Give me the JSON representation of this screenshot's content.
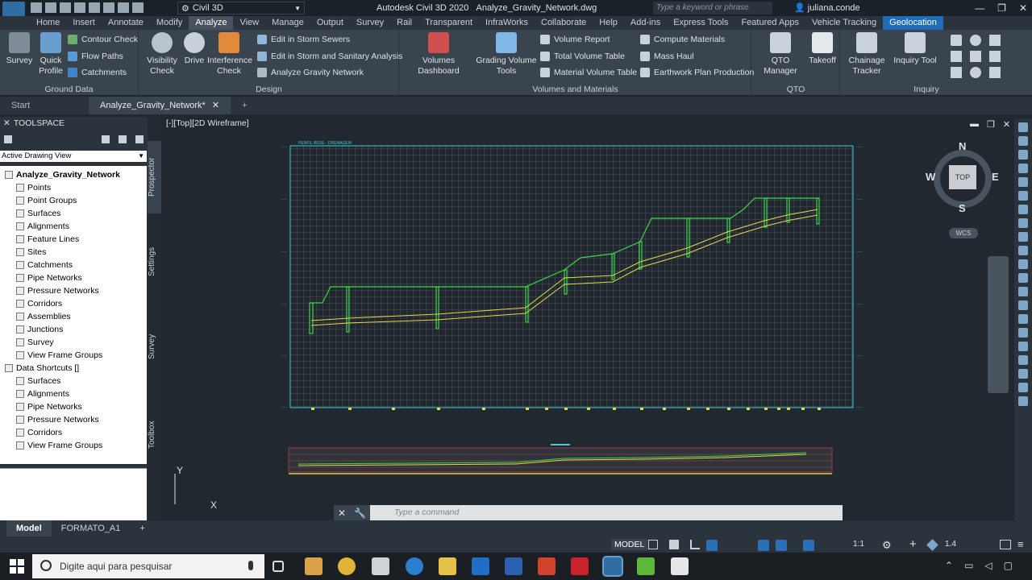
{
  "titlebar": {
    "logo_text": "C3D",
    "workspace": "Civil 3D",
    "title": "Autodesk Civil 3D 2020",
    "file": "Analyze_Gravity_Network.dwg",
    "search_placeholder": "Type a keyword or phrase",
    "user": "juliana.conde"
  },
  "tabs": [
    "Home",
    "Insert",
    "Annotate",
    "Modify",
    "Analyze",
    "View",
    "Manage",
    "Output",
    "Survey",
    "Rail",
    "Transparent",
    "InfraWorks",
    "Collaborate",
    "Help",
    "Add-ins",
    "Express Tools",
    "Featured Apps",
    "Vehicle Tracking",
    "Geolocation"
  ],
  "active_tab": "Analyze",
  "ribbon": {
    "ground": {
      "title": "Ground Data",
      "survey": "Survey",
      "quick_profile": "Quick Profile",
      "contour_check": "Contour Check",
      "flow_paths": "Flow Paths",
      "catchments": "Catchments"
    },
    "design": {
      "title": "Design",
      "visibility": "Visibility Check",
      "drive": "Drive",
      "interference": "Interference Check",
      "storm": "Edit in Storm Sewers",
      "storm_sanitary": "Edit in Storm and Sanitary Analysis",
      "gravity": "Analyze Gravity Network"
    },
    "volumes": {
      "title": "Volumes and Materials",
      "dashboard": "Volumes Dashboard",
      "grading": "Grading Volume Tools",
      "volume_report": "Volume Report",
      "total_volume": "Total Volume Table",
      "material_volume": "Material Volume Table",
      "compute": "Compute Materials",
      "mass_haul": "Mass Haul",
      "earthwork": "Earthwork Plan Production"
    },
    "qto": {
      "title": "QTO",
      "manager": "QTO Manager",
      "takeoff": "Takeoff"
    },
    "inquiry": {
      "title": "Inquiry",
      "chainage": "Chainage Tracker",
      "inquiry_tool": "Inquiry Tool"
    }
  },
  "doc_tabs": [
    "Start",
    "Analyze_Gravity_Network*"
  ],
  "toolspace": {
    "title": "TOOLSPACE",
    "view": "Active Drawing View",
    "tree": [
      {
        "label": "Analyze_Gravity_Network",
        "level": 0,
        "bold": true
      },
      {
        "label": "Points",
        "level": 1
      },
      {
        "label": "Point Groups",
        "level": 1
      },
      {
        "label": "Surfaces",
        "level": 1
      },
      {
        "label": "Alignments",
        "level": 1
      },
      {
        "label": "Feature Lines",
        "level": 1
      },
      {
        "label": "Sites",
        "level": 1
      },
      {
        "label": "Catchments",
        "level": 1
      },
      {
        "label": "Pipe Networks",
        "level": 1
      },
      {
        "label": "Pressure Networks",
        "level": 1
      },
      {
        "label": "Corridors",
        "level": 1
      },
      {
        "label": "Assemblies",
        "level": 1
      },
      {
        "label": "Junctions",
        "level": 1
      },
      {
        "label": "Survey",
        "level": 1
      },
      {
        "label": "View Frame Groups",
        "level": 1
      },
      {
        "label": "Data Shortcuts []",
        "level": 0
      },
      {
        "label": "Surfaces",
        "level": 1
      },
      {
        "label": "Alignments",
        "level": 1
      },
      {
        "label": "Pipe Networks",
        "level": 1
      },
      {
        "label": "Pressure Networks",
        "level": 1
      },
      {
        "label": "Corridors",
        "level": 1
      },
      {
        "label": "View Frame Groups",
        "level": 1
      }
    ],
    "vtabs": [
      "Prospector",
      "Settings",
      "Survey",
      "Toolbox"
    ]
  },
  "viewport": {
    "label": "[-][Top][2D Wireframe]",
    "profile_title": "PERFIL REDE - DRENAGEM",
    "compass": {
      "n": "N",
      "s": "S",
      "e": "E",
      "w": "W",
      "top": "TOP",
      "wcs": "WCS"
    }
  },
  "command": {
    "placeholder": "Type a command"
  },
  "layout_tabs": [
    "Model",
    "FORMATO_A1"
  ],
  "status": {
    "model": "MODEL",
    "scale": "1:1",
    "zoom": "1.4"
  },
  "taskbar": {
    "search": "Digite aqui para pesquisar"
  }
}
